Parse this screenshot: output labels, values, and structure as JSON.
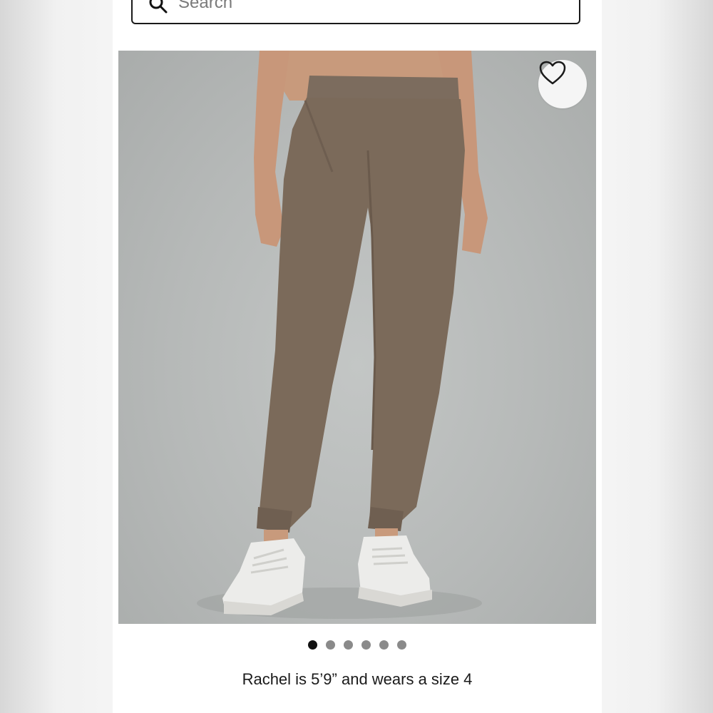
{
  "search": {
    "placeholder": "Search",
    "icon": "search-icon"
  },
  "product": {
    "wishlist_icon": "heart-icon",
    "image_count": 6,
    "active_image": 1,
    "model_caption": "Rachel is 5’9” and wears a size 4"
  },
  "colors": {
    "border": "#1a1a1a",
    "dot_active": "#111111",
    "dot_inactive": "#8a8a8a"
  }
}
